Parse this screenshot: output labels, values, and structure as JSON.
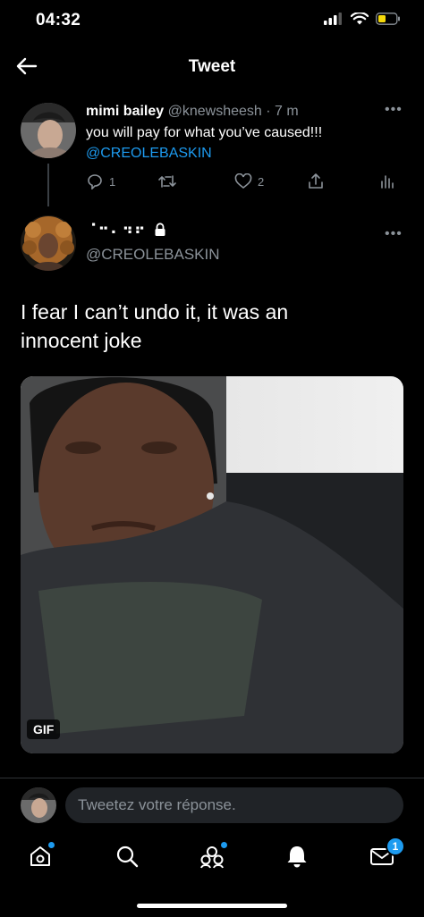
{
  "status": {
    "time": "04:32"
  },
  "header": {
    "title": "Tweet"
  },
  "parent_tweet": {
    "display_name": "mimi bailey",
    "handle": "@knewsheesh",
    "time": "· 7 m",
    "text": "you will pay for what you’ve caused!!!",
    "mention": "@CREOLEBASKIN",
    "reply_count": "1",
    "like_count": "2"
  },
  "main_tweet": {
    "display_name": "⠈⠒⠄⠲⠖",
    "handle": "@CREOLEBASKIN",
    "text": "I fear I can’t undo it, it was an innocent joke",
    "media_badge": "GIF"
  },
  "reply": {
    "placeholder": "Tweetez votre réponse."
  },
  "tabbar": {
    "messages_badge": "1"
  },
  "colors": {
    "accent": "#1d9bf0",
    "background": "#000000",
    "muted": "#8b9299"
  }
}
